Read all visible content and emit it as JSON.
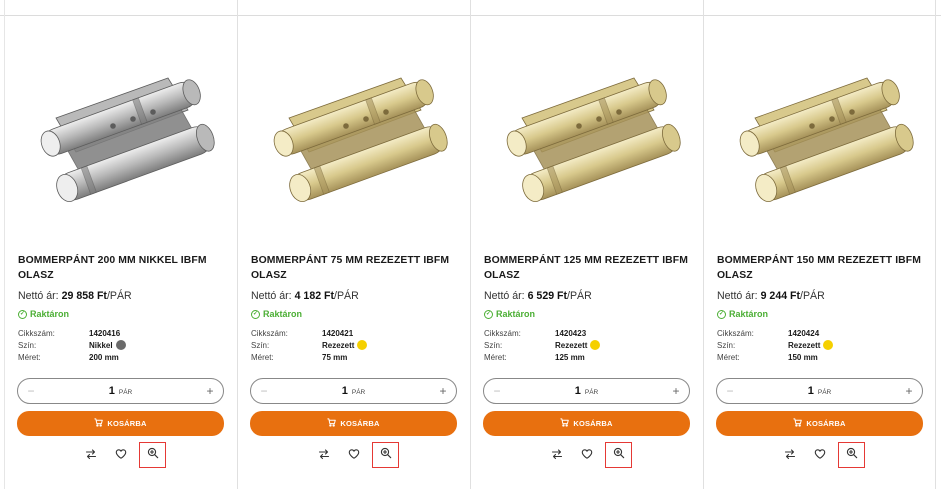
{
  "labels": {
    "price_prefix": "Nettó ár:",
    "price_suffix": "/PÁR",
    "spec_code": "Cikkszám:",
    "spec_color": "Szín:",
    "spec_size": "Méret:",
    "qty_minus": "−",
    "qty_plus": "+",
    "cart_button": "KOSÁRBA"
  },
  "products": [
    {
      "title": "BOMMERPÁNT 200 MM NIKKEL IBFM OLASZ",
      "price": "29 858 Ft",
      "stock": "Raktáron",
      "code": "1420416",
      "color": "Nikkel",
      "color_hex": "#6b6b6b",
      "size": "200 mm",
      "qty": "1",
      "unit": "PÁR",
      "finish": "nickel"
    },
    {
      "title": "BOMMERPÁNT 75 MM REZEZETT IBFM OLASZ",
      "price": "4 182 Ft",
      "stock": "Raktáron",
      "code": "1420421",
      "color": "Rezezett",
      "color_hex": "#f5d000",
      "size": "75 mm",
      "qty": "1",
      "unit": "PÁR",
      "finish": "brass"
    },
    {
      "title": "BOMMERPÁNT 125 MM REZEZETT IBFM OLASZ",
      "price": "6 529 Ft",
      "stock": "Raktáron",
      "code": "1420423",
      "color": "Rezezett",
      "color_hex": "#f5d000",
      "size": "125 mm",
      "qty": "1",
      "unit": "PÁR",
      "finish": "brass"
    },
    {
      "title": "BOMMERPÁNT 150 MM REZEZETT IBFM OLASZ",
      "price": "9 244 Ft",
      "stock": "Raktáron",
      "code": "1420424",
      "color": "Rezezett",
      "color_hex": "#f5d000",
      "size": "150 mm",
      "qty": "1",
      "unit": "PÁR",
      "finish": "brass"
    }
  ],
  "icons": {
    "compare": "compare-arrows-icon",
    "favorite": "heart-icon",
    "zoom": "zoom-in-icon",
    "cart": "cart-icon",
    "stock": "check-circle-icon"
  },
  "colors": {
    "accent": "#e8700f",
    "stock_green": "#4caf35",
    "highlight_red": "#e53935"
  }
}
